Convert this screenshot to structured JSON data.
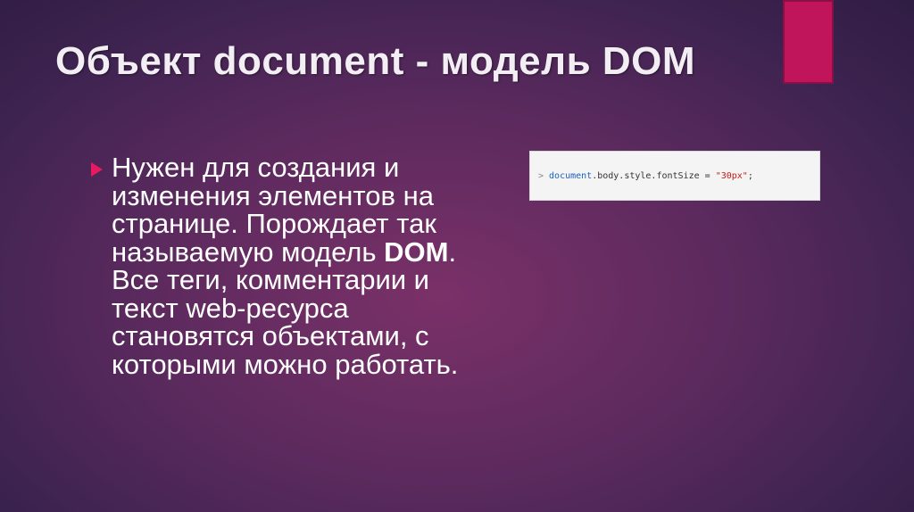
{
  "slide": {
    "title": "Объект document - модель DOM",
    "bullet": {
      "text_before": "Нужен для создания и изменения элементов на странице. Порождает так называемую модель ",
      "bold_term": "DOM",
      "text_after": ". Все теги, комментарии и текст web-ресурса становятся объектами, с которыми можно работать."
    },
    "console": {
      "prompt": ">",
      "object": "document",
      "expression": ".body.style.fontSize = ",
      "string_value": "\"30px\"",
      "terminator": ";"
    },
    "colors": {
      "accent": "#c0155b",
      "bullet": "#e8195f",
      "background": "#5c2a5e"
    },
    "icons": {
      "bullet": "triangle-bullet-icon"
    }
  }
}
